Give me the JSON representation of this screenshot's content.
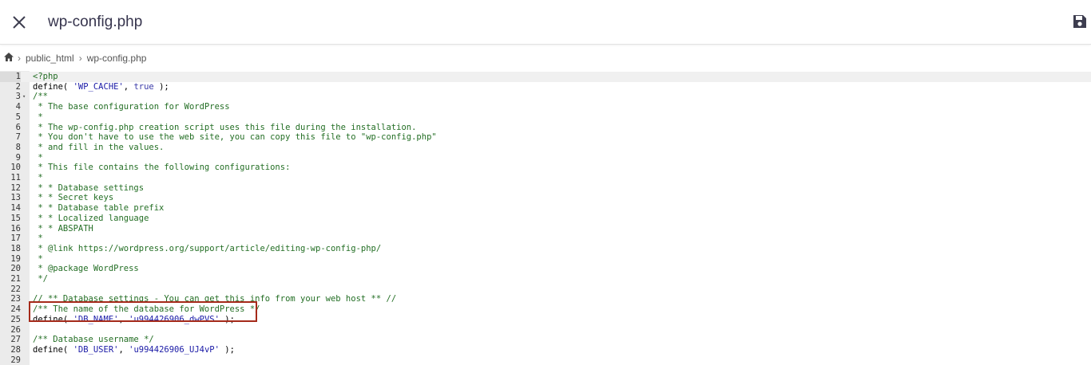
{
  "header": {
    "close_icon": "close-icon",
    "title": "wp-config.php",
    "save_icon": "floppy-disk-icon"
  },
  "breadcrumb": {
    "home_icon": "home-icon",
    "items": [
      "public_html",
      "wp-config.php"
    ]
  },
  "editor": {
    "lines": [
      {
        "n": "1",
        "text": "<?php"
      },
      {
        "n": "2",
        "text": "define( 'WP_CACHE', true );"
      },
      {
        "n": "3",
        "text": "/**"
      },
      {
        "n": "4",
        "text": " * The base configuration for WordPress"
      },
      {
        "n": "5",
        "text": " *"
      },
      {
        "n": "6",
        "text": " * The wp-config.php creation script uses this file during the installation."
      },
      {
        "n": "7",
        "text": " * You don't have to use the web site, you can copy this file to \"wp-config.php\""
      },
      {
        "n": "8",
        "text": " * and fill in the values."
      },
      {
        "n": "9",
        "text": " *"
      },
      {
        "n": "10",
        "text": " * This file contains the following configurations:"
      },
      {
        "n": "11",
        "text": " *"
      },
      {
        "n": "12",
        "text": " * * Database settings"
      },
      {
        "n": "13",
        "text": " * * Secret keys"
      },
      {
        "n": "14",
        "text": " * * Database table prefix"
      },
      {
        "n": "15",
        "text": " * * Localized language"
      },
      {
        "n": "16",
        "text": " * * ABSPATH"
      },
      {
        "n": "17",
        "text": " *"
      },
      {
        "n": "18",
        "text": " * @link https://wordpress.org/support/article/editing-wp-config-php/"
      },
      {
        "n": "19",
        "text": " *"
      },
      {
        "n": "20",
        "text": " * @package WordPress"
      },
      {
        "n": "21",
        "text": " */"
      },
      {
        "n": "22",
        "text": ""
      },
      {
        "n": "23",
        "text": "// ** Database settings - You can get this info from your web host ** //"
      },
      {
        "n": "24",
        "text": "/** The name of the database for WordPress */"
      },
      {
        "n": "25",
        "text": "define( 'DB_NAME', 'u994426906_dwPVS' );"
      },
      {
        "n": "26",
        "text": ""
      },
      {
        "n": "27",
        "text": "/** Database username */"
      },
      {
        "n": "28",
        "text": "define( 'DB_USER', 'u994426906_UJ4vP' );"
      },
      {
        "n": "29",
        "text": ""
      }
    ]
  },
  "colors": {
    "highlight_border": "#a52a1a",
    "comment": "#236e24",
    "string": "#1a1aa6",
    "gutter": "#ebebeb"
  }
}
